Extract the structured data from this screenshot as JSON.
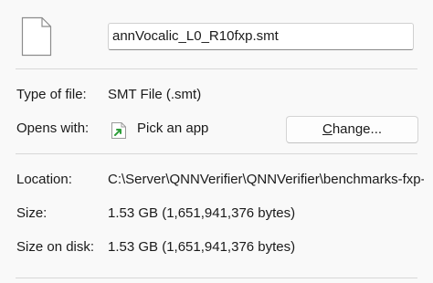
{
  "file": {
    "icon": "blank-document-icon",
    "name": "annVocalic_L0_R10fxp.smt"
  },
  "type": {
    "label": "Type of file:",
    "value": "SMT File (.smt)"
  },
  "opens_with": {
    "label": "Opens with:",
    "app_icon": "pick-app-icon",
    "app_name": "Pick an app",
    "change_button": {
      "mnemonic": "C",
      "rest": "hange..."
    }
  },
  "location": {
    "label": "Location:",
    "value": "C:\\Server\\QNNVerifier\\QNNVerifier\\benchmarks-fxp-la"
  },
  "size": {
    "label": "Size:",
    "value": "1.53 GB (1,651,941,376 bytes)"
  },
  "size_on_disk": {
    "label": "Size on disk:",
    "value": "1.53 GB (1,651,941,376 bytes)"
  },
  "colors": {
    "panel_background": "#f9f9f9",
    "app_icon_arrow": "#2e9e3a"
  }
}
